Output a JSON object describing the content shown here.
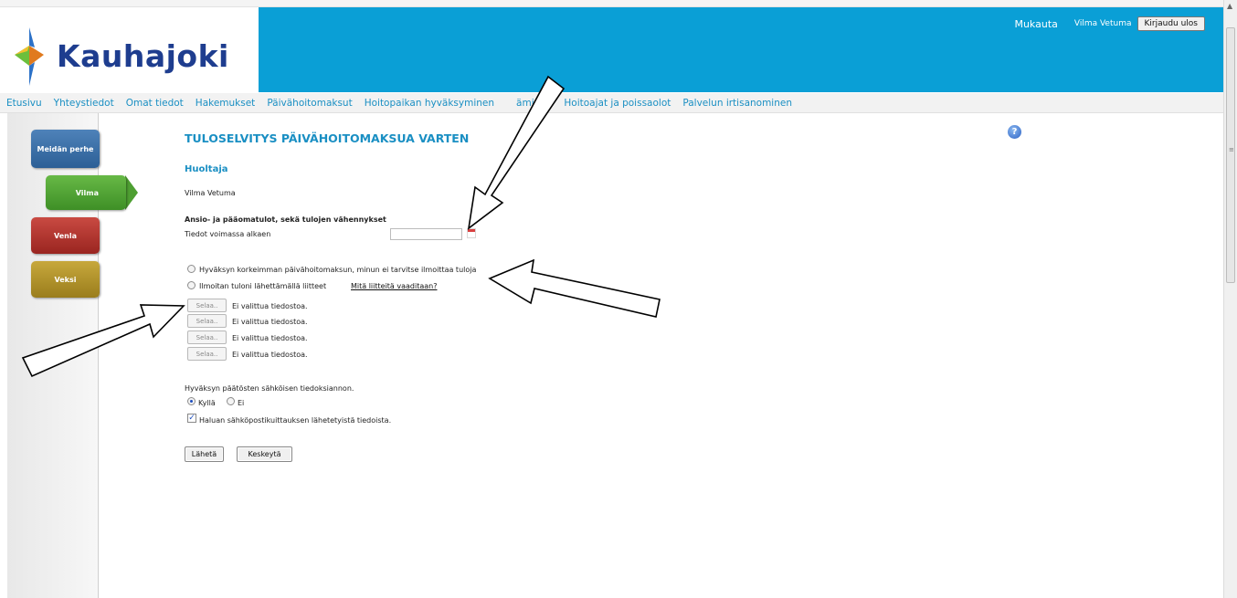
{
  "header": {
    "logo_text": "Kauhajoki",
    "customize_link": "Mukauta",
    "user_name": "Vilma Vetuma",
    "logout_label": "Kirjaudu ulos"
  },
  "nav": {
    "items": [
      "Etusivu",
      "Yhteystiedot",
      "Omat tiedot",
      "Hakemukset",
      "Päivähoitomaksut",
      "Hoitopaikan hyväksyminen",
      "äminen",
      "Hoitoajat ja poissaolot",
      "Palvelun irtisanominen"
    ]
  },
  "sidebar": {
    "tabs": [
      "Meidän perhe",
      "Vilma",
      "Venla",
      "Veksi"
    ]
  },
  "form": {
    "title": "TULOSELVITYS PÄIVÄHOITOMAKSUA VARTEN",
    "section": "Huoltaja",
    "guardian_name": "Vilma Vetuma",
    "income_heading": "Ansio- ja pääomatulot, sekä tulojen vähennykset",
    "valid_from_label": "Tiedot voimassa alkaen",
    "valid_from_value": "",
    "option_max_fee": "Hyväksyn korkeimman päivähoitomaksun, minun ei tarvitse ilmoittaa tuloja",
    "option_attachments": "Ilmoitan tuloni lähettämällä liitteet",
    "attachments_help_link": "Mitä liitteitä vaaditaan?",
    "browse_label": "Selaa..",
    "no_file_text": "Ei valittua tiedostoa.",
    "e_notice_label": "Hyväksyn päätösten sähköisen tiedoksiannon.",
    "yes_label": "Kyllä",
    "no_label": "Ei",
    "yes_selected": true,
    "email_receipt_label": "Haluan sähköpostikuittauksen lähetetyistä tiedoista.",
    "email_receipt_checked": true,
    "submit_label": "Lähetä",
    "cancel_label": "Keskeytä",
    "help_icon": "?"
  },
  "colors": {
    "header_blue": "#0a9fd6",
    "link_blue": "#1a8fc3",
    "logo_navy": "#1e3d8f",
    "tab_blue": "#3a6ea8",
    "tab_green": "#4e9f32",
    "tab_red": "#b0342e",
    "tab_gold": "#b39129"
  }
}
